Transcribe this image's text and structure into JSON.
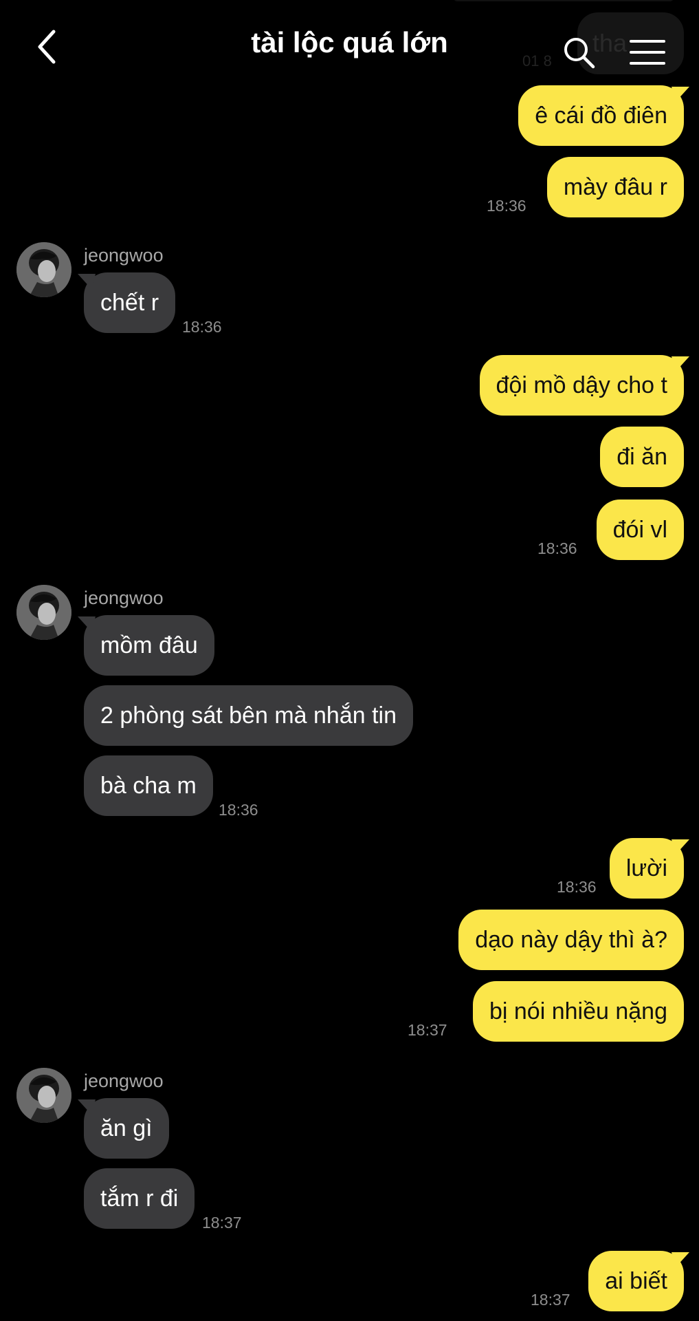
{
  "header": {
    "title": "tài lộc quá lớn",
    "back_icon": "chevron-left-icon",
    "search_icon": "search-icon",
    "menu_icon": "hamburger-menu-icon"
  },
  "partial_top": {
    "bubble_text": "tha"
  },
  "colors": {
    "background": "#000000",
    "outgoing_bubble": "#fbe64a",
    "incoming_bubble": "#3a3a3c",
    "timestamp": "#8e8e8e"
  },
  "messages": [
    {
      "dir": "out",
      "text": "ê cái đồ điên"
    },
    {
      "dir": "out",
      "text": "mày đâu r",
      "time": "18:36"
    },
    {
      "dir": "in",
      "sender": "jeongwoo",
      "text": "chết r",
      "time": "18:36"
    },
    {
      "dir": "out",
      "text": "đội mồ dậy cho t"
    },
    {
      "dir": "out",
      "text": "đi ăn"
    },
    {
      "dir": "out",
      "text": "đói vl",
      "time": "18:36"
    },
    {
      "dir": "in",
      "sender": "jeongwoo",
      "text": "mồm đâu"
    },
    {
      "dir": "in",
      "text": "2 phòng sát bên mà nhắn tin"
    },
    {
      "dir": "in",
      "text": "bà cha m",
      "time": "18:36"
    },
    {
      "dir": "out",
      "text": "lười",
      "time": "18:36"
    },
    {
      "dir": "out",
      "text": "dạo này dậy thì à?"
    },
    {
      "dir": "out",
      "text": "bị nói nhiều nặng",
      "time": "18:37"
    },
    {
      "dir": "in",
      "sender": "jeongwoo",
      "text": "ăn gì"
    },
    {
      "dir": "in",
      "text": "tắm r đi",
      "time": "18:37"
    },
    {
      "dir": "out",
      "text": "ai biết",
      "time": "18:37"
    }
  ]
}
